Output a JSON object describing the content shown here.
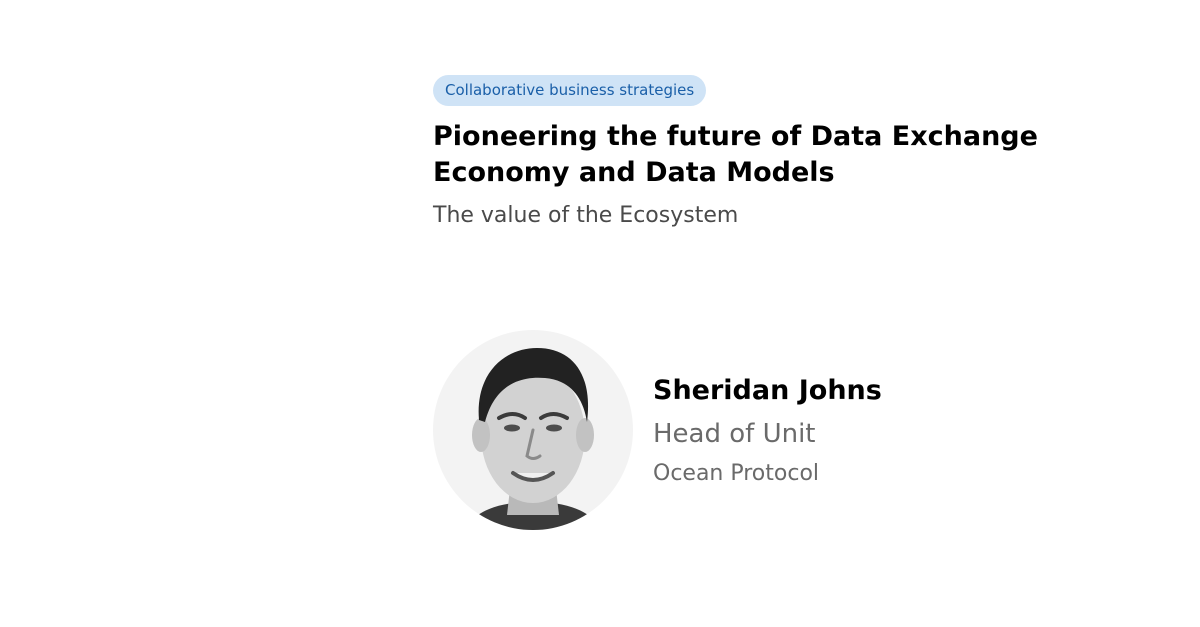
{
  "tag": {
    "label": "Collaborative business strategies",
    "color": "#1a5fa8",
    "background": "#cfe3f6"
  },
  "session": {
    "title": "Pioneering the future of Data Exchange Economy and Data Models",
    "subtitle": "The value of the Ecosystem"
  },
  "speaker": {
    "name": "Sheridan Johns",
    "role": "Head of Unit",
    "organization": "Ocean Protocol",
    "photo_icon": "portrait-photo-icon"
  }
}
